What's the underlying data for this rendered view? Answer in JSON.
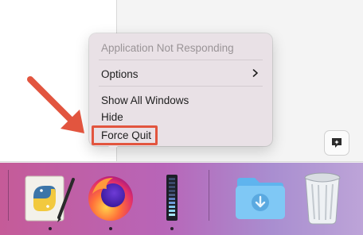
{
  "context_menu": {
    "status_label": "Application Not Responding",
    "options_label": "Options",
    "show_all_windows_label": "Show All Windows",
    "hide_label": "Hide",
    "force_quit_label": "Force Quit"
  },
  "dock": {
    "apps": [
      {
        "name": "Python Launcher",
        "icon": "python-icon",
        "running": true
      },
      {
        "name": "Firefox",
        "icon": "firefox-icon",
        "running": true
      },
      {
        "name": "Activity Monitor",
        "icon": "activity-monitor-icon",
        "running": true
      },
      {
        "name": "Downloads",
        "icon": "downloads-folder-icon",
        "running": false
      },
      {
        "name": "Trash",
        "icon": "trash-icon",
        "running": false
      }
    ]
  },
  "colors": {
    "highlight": "#e2553f",
    "menu_bg": "#e9e1e6",
    "dock_left": "#c55b98",
    "dock_right": "#bda4d8"
  }
}
